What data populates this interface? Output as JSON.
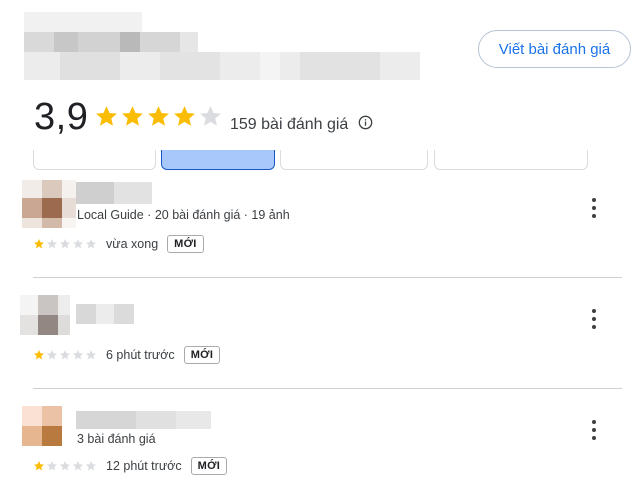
{
  "header": {
    "write_review_label": "Viết bài đánh giá",
    "rating": "3,9",
    "rating_stars": 4,
    "review_count_label": "159 bài đánh giá"
  },
  "reviews": [
    {
      "meta": "Local Guide · 20 bài đánh giá · 19 ảnh",
      "stars": 1,
      "time": "vừa xong",
      "badge": "MỚI"
    },
    {
      "meta": "",
      "stars": 1,
      "time": "6 phút trước",
      "badge": "MỚI"
    },
    {
      "meta": "3 bài đánh giá",
      "stars": 1,
      "time": "12 phút trước",
      "badge": "MỚI"
    }
  ],
  "colors": {
    "star_filled": "#fbbc04",
    "star_empty": "#dadce0",
    "accent": "#1a73e8"
  }
}
